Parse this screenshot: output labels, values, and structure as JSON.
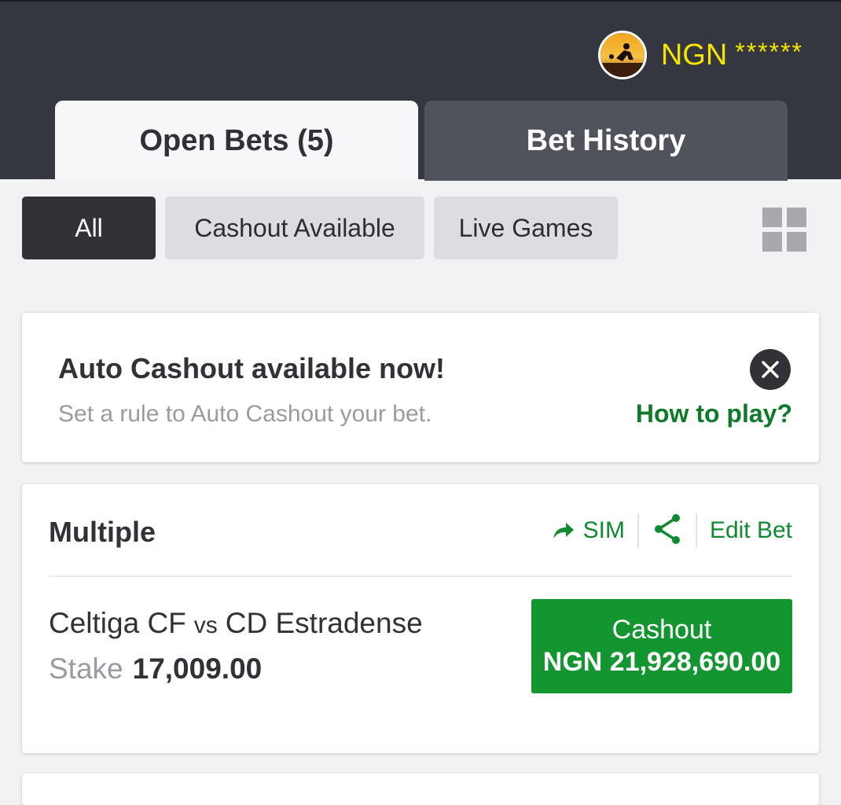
{
  "account": {
    "currency": "NGN",
    "balance_masked": "******",
    "avatar_icon": "user-avatar-icon"
  },
  "tabs": [
    {
      "label": "Open Bets (5)",
      "active": true
    },
    {
      "label": "Bet History",
      "active": false
    }
  ],
  "filters": [
    {
      "label": "All",
      "selected": true
    },
    {
      "label": "Cashout Available",
      "selected": false
    },
    {
      "label": "Live Games",
      "selected": false
    }
  ],
  "view_toggle_icon": "grid-view-icon",
  "auto_cashout_banner": {
    "title": "Auto Cashout available now!",
    "subtitle": "Set a rule to Auto Cashout your bet.",
    "link": "How to play?",
    "close_icon": "close-icon"
  },
  "bet": {
    "type": "Multiple",
    "actions": {
      "sim_label": "SIM",
      "share_icon": "share-icon",
      "edit_label": "Edit Bet"
    },
    "home_team": "Celtiga CF",
    "vs": "vs",
    "away_team": "CD Estradense",
    "stake_label": "Stake",
    "stake_value": "17,009.00",
    "cashout_label": "Cashout",
    "cashout_amount": "NGN 21,928,690.00"
  },
  "colors": {
    "header_bg": "#353740",
    "accent_yellow": "#f5e400",
    "cashout_green": "#13962f",
    "link_green": "#0f7a2a"
  }
}
